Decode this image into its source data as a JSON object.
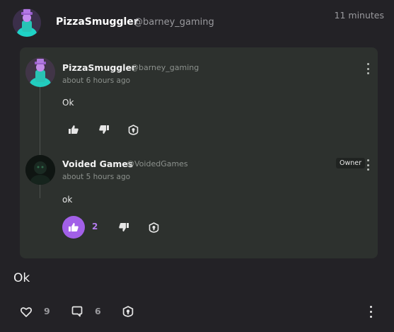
{
  "post": {
    "author_name": "PizzaSmuggler",
    "author_handle": "@barney_gaming",
    "time": "11 minutes",
    "text": "Ok",
    "likes": "9",
    "comments": "6"
  },
  "quote": {
    "comments": [
      {
        "name": "PizzaSmuggler",
        "handle": "@barney_gaming",
        "time": "about 6 hours ago",
        "text": "Ok"
      },
      {
        "name": "Voided Games",
        "handle": "@VoidedGames",
        "badge": "Owner",
        "time": "about 5 hours ago",
        "text": "ok",
        "likes": "2"
      }
    ]
  },
  "icons": {
    "like": "thumbs-up-icon",
    "dislike": "thumbs-down-icon",
    "reward": "award-icon",
    "heart": "heart-icon",
    "comment": "comment-icon",
    "more": "more-vertical-icon"
  },
  "colors": {
    "background": "#232226",
    "card": "#2d312e",
    "accent": "#a260e8"
  }
}
